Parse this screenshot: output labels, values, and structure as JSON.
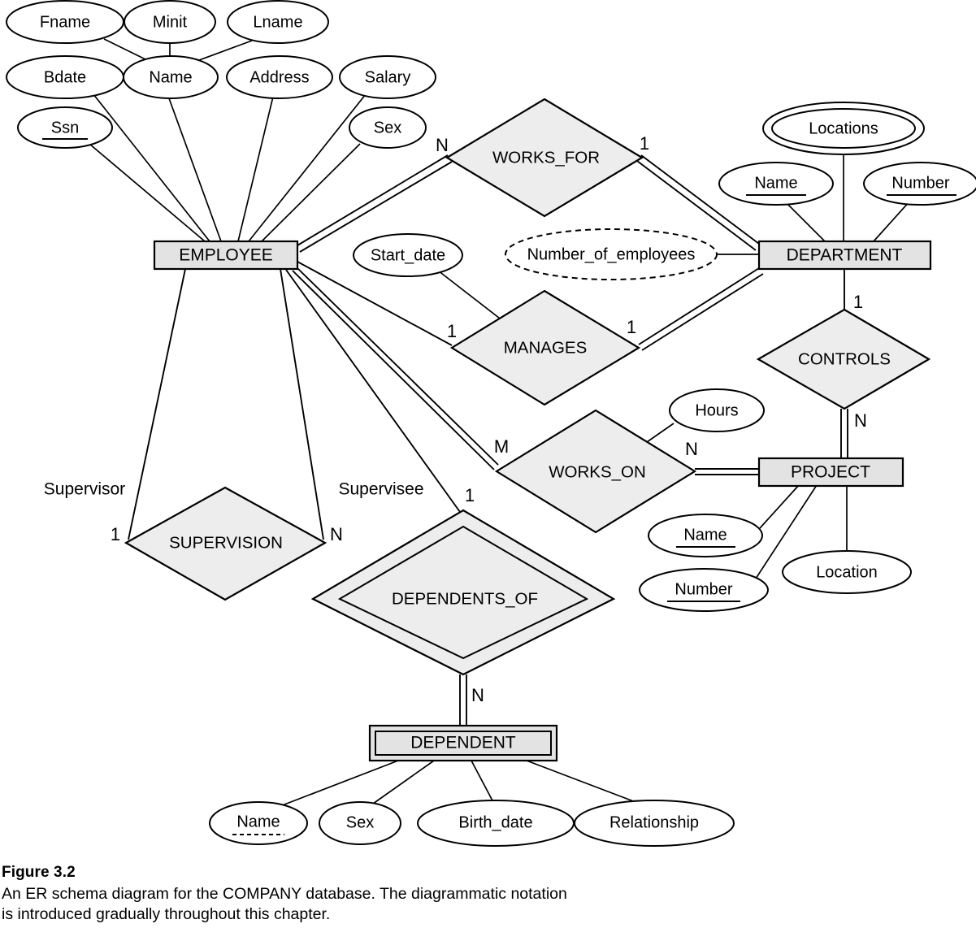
{
  "figure": {
    "number_label": "Figure 3.2",
    "caption_line1": "An ER schema diagram for the COMPANY database. The diagrammatic notation",
    "caption_line2": "is introduced gradually throughout this chapter."
  },
  "colors": {
    "entity_fill": "#e3e3e3",
    "relationship_fill": "#ededed",
    "attribute_fill": "#ffffff",
    "stroke": "#000000",
    "background": "#ffffff"
  },
  "entities": [
    {
      "id": "employee",
      "label": "EMPLOYEE",
      "weak": false
    },
    {
      "id": "department",
      "label": "DEPARTMENT",
      "weak": false
    },
    {
      "id": "project",
      "label": "PROJECT",
      "weak": false
    },
    {
      "id": "dependent",
      "label": "DEPENDENT",
      "weak": true
    }
  ],
  "relationships": [
    {
      "id": "works_for",
      "label": "WORKS_FOR",
      "identifying": false
    },
    {
      "id": "manages",
      "label": "MANAGES",
      "identifying": false
    },
    {
      "id": "controls",
      "label": "CONTROLS",
      "identifying": false
    },
    {
      "id": "works_on",
      "label": "WORKS_ON",
      "identifying": false
    },
    {
      "id": "supervision",
      "label": "SUPERVISION",
      "identifying": false
    },
    {
      "id": "dependents_of",
      "label": "DEPENDENTS_OF",
      "identifying": true
    }
  ],
  "attributes": {
    "employee": [
      {
        "label": "Fname",
        "kind": "simple"
      },
      {
        "label": "Minit",
        "kind": "simple"
      },
      {
        "label": "Lname",
        "kind": "simple"
      },
      {
        "label": "Name",
        "kind": "composite"
      },
      {
        "label": "Bdate",
        "kind": "simple"
      },
      {
        "label": "Address",
        "kind": "simple"
      },
      {
        "label": "Salary",
        "kind": "simple"
      },
      {
        "label": "Ssn",
        "kind": "key"
      },
      {
        "label": "Sex",
        "kind": "simple"
      }
    ],
    "department": [
      {
        "label": "Name",
        "kind": "key"
      },
      {
        "label": "Number",
        "kind": "key"
      },
      {
        "label": "Locations",
        "kind": "multivalued"
      },
      {
        "label": "Number_of_employees",
        "kind": "derived"
      }
    ],
    "project": [
      {
        "label": "Name",
        "kind": "key"
      },
      {
        "label": "Number",
        "kind": "key"
      },
      {
        "label": "Location",
        "kind": "simple"
      }
    ],
    "dependent": [
      {
        "label": "Name",
        "kind": "partial-key"
      },
      {
        "label": "Sex",
        "kind": "simple"
      },
      {
        "label": "Birth_date",
        "kind": "simple"
      },
      {
        "label": "Relationship",
        "kind": "simple"
      }
    ],
    "relationship_attributes": [
      {
        "owner": "manages",
        "label": "Start_date",
        "kind": "simple"
      },
      {
        "owner": "works_on",
        "label": "Hours",
        "kind": "simple"
      }
    ]
  },
  "cardinalities": {
    "works_for_employee": "N",
    "works_for_department": "1",
    "manages_employee": "1",
    "manages_department": "1",
    "controls_department": "1",
    "controls_project": "N",
    "works_on_employee": "M",
    "works_on_project": "N",
    "supervision_supervisor": "1",
    "supervision_supervisee": "N",
    "dependents_of_employee": "1",
    "dependents_of_dependent": "N"
  },
  "roles": {
    "supervisor": "Supervisor",
    "supervisee": "Supervisee"
  },
  "chart_data": {
    "type": "diagram",
    "title": "ER schema diagram for the COMPANY database",
    "notation": "Chen ER notation",
    "legend": {
      "rectangle": "entity type",
      "double_rectangle": "weak entity type",
      "diamond": "relationship type",
      "double_diamond": "identifying relationship type",
      "oval": "attribute",
      "double_oval": "multivalued attribute",
      "dashed_oval": "derived attribute",
      "solid_underline": "key attribute",
      "dashed_underline": "partial key attribute",
      "double_line": "total participation",
      "single_line": "partial participation"
    },
    "edges": [
      {
        "from": "EMPLOYEE",
        "relationship": "WORKS_FOR",
        "to": "DEPARTMENT",
        "from_card": "N",
        "to_card": "1",
        "from_participation": "total",
        "to_participation": "total"
      },
      {
        "from": "EMPLOYEE",
        "relationship": "MANAGES",
        "to": "DEPARTMENT",
        "from_card": "1",
        "to_card": "1",
        "from_participation": "partial",
        "to_participation": "total"
      },
      {
        "from": "DEPARTMENT",
        "relationship": "CONTROLS",
        "to": "PROJECT",
        "from_card": "1",
        "to_card": "N",
        "from_participation": "partial",
        "to_participation": "total"
      },
      {
        "from": "EMPLOYEE",
        "relationship": "WORKS_ON",
        "to": "PROJECT",
        "from_card": "M",
        "to_card": "N",
        "from_participation": "total",
        "to_participation": "total"
      },
      {
        "from": "EMPLOYEE",
        "relationship": "SUPERVISION",
        "to": "EMPLOYEE",
        "from_card": "1",
        "to_card": "N",
        "from_role": "Supervisor",
        "to_role": "Supervisee",
        "from_participation": "partial",
        "to_participation": "partial"
      },
      {
        "from": "EMPLOYEE",
        "relationship": "DEPENDENTS_OF",
        "to": "DEPENDENT",
        "from_card": "1",
        "to_card": "N",
        "from_participation": "partial",
        "to_participation": "total"
      }
    ]
  }
}
